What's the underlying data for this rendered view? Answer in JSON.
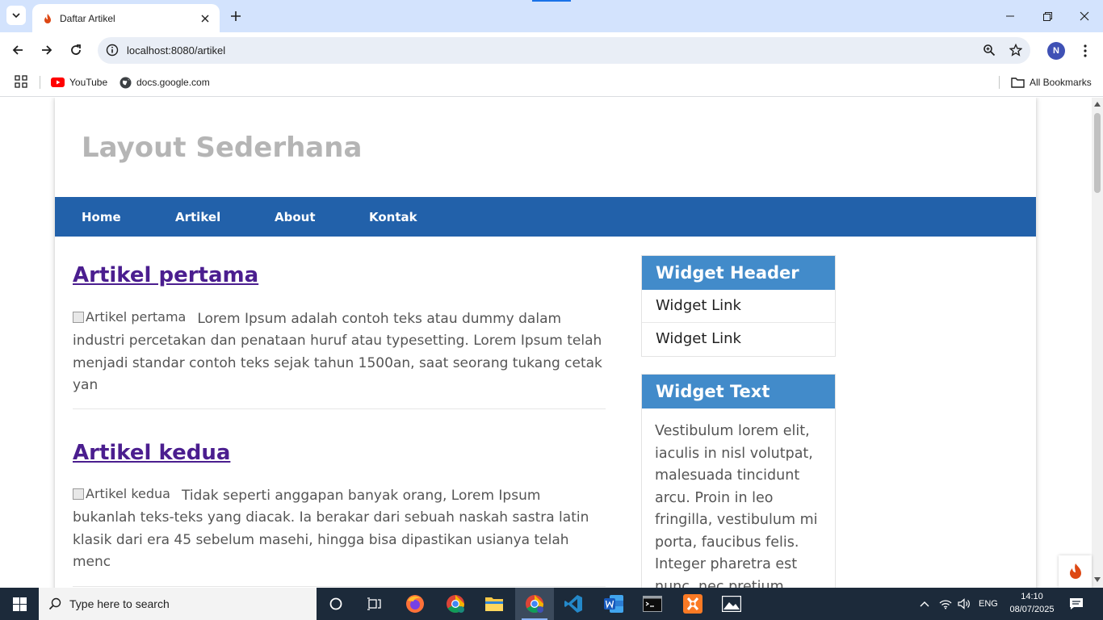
{
  "browser": {
    "tab_title": "Daftar Artikel",
    "url": "localhost:8080/artikel",
    "profile_initial": "N",
    "bookmarks": [
      {
        "label": "YouTube",
        "icon": "youtube-icon"
      },
      {
        "label": "docs.google.com",
        "icon": "globe-icon"
      }
    ],
    "all_bookmarks_label": "All Bookmarks"
  },
  "page": {
    "site_title": "Layout Sederhana",
    "nav": [
      "Home",
      "Artikel",
      "About",
      "Kontak"
    ],
    "articles": [
      {
        "title": "Artikel pertama",
        "img_alt": "Artikel pertama",
        "excerpt": "Lorem Ipsum adalah contoh teks atau dummy dalam industri percetakan dan penataan huruf atau typesetting. Lorem Ipsum telah menjadi standar contoh teks sejak tahun 1500an, saat seorang tukang cetak yan"
      },
      {
        "title": "Artikel kedua",
        "img_alt": "Artikel kedua",
        "excerpt": "Tidak seperti anggapan banyak orang, Lorem Ipsum bukanlah teks-teks yang diacak. Ia berakar dari sebuah naskah sastra latin klasik dari era 45 sebelum masehi, hingga bisa dipastikan usianya telah menc"
      }
    ],
    "widgets": {
      "header_title": "Widget Header",
      "links": [
        "Widget Link",
        "Widget Link"
      ],
      "text_title": "Widget Text",
      "text_body": "Vestibulum lorem elit, iaculis in nisl volutpat, malesuada tincidunt arcu. Proin in leo fringilla, vestibulum mi porta, faucibus felis. Integer pharetra est nunc, nec pretium nunc"
    }
  },
  "taskbar": {
    "search_placeholder": "Type here to search",
    "language": "ENG",
    "time": "14:10",
    "date": "08/07/2025"
  },
  "colors": {
    "nav_bg": "#2261aa",
    "widget_head_bg": "#428bca",
    "article_title": "#4b1e8f",
    "site_title": "#b5b5b5"
  }
}
